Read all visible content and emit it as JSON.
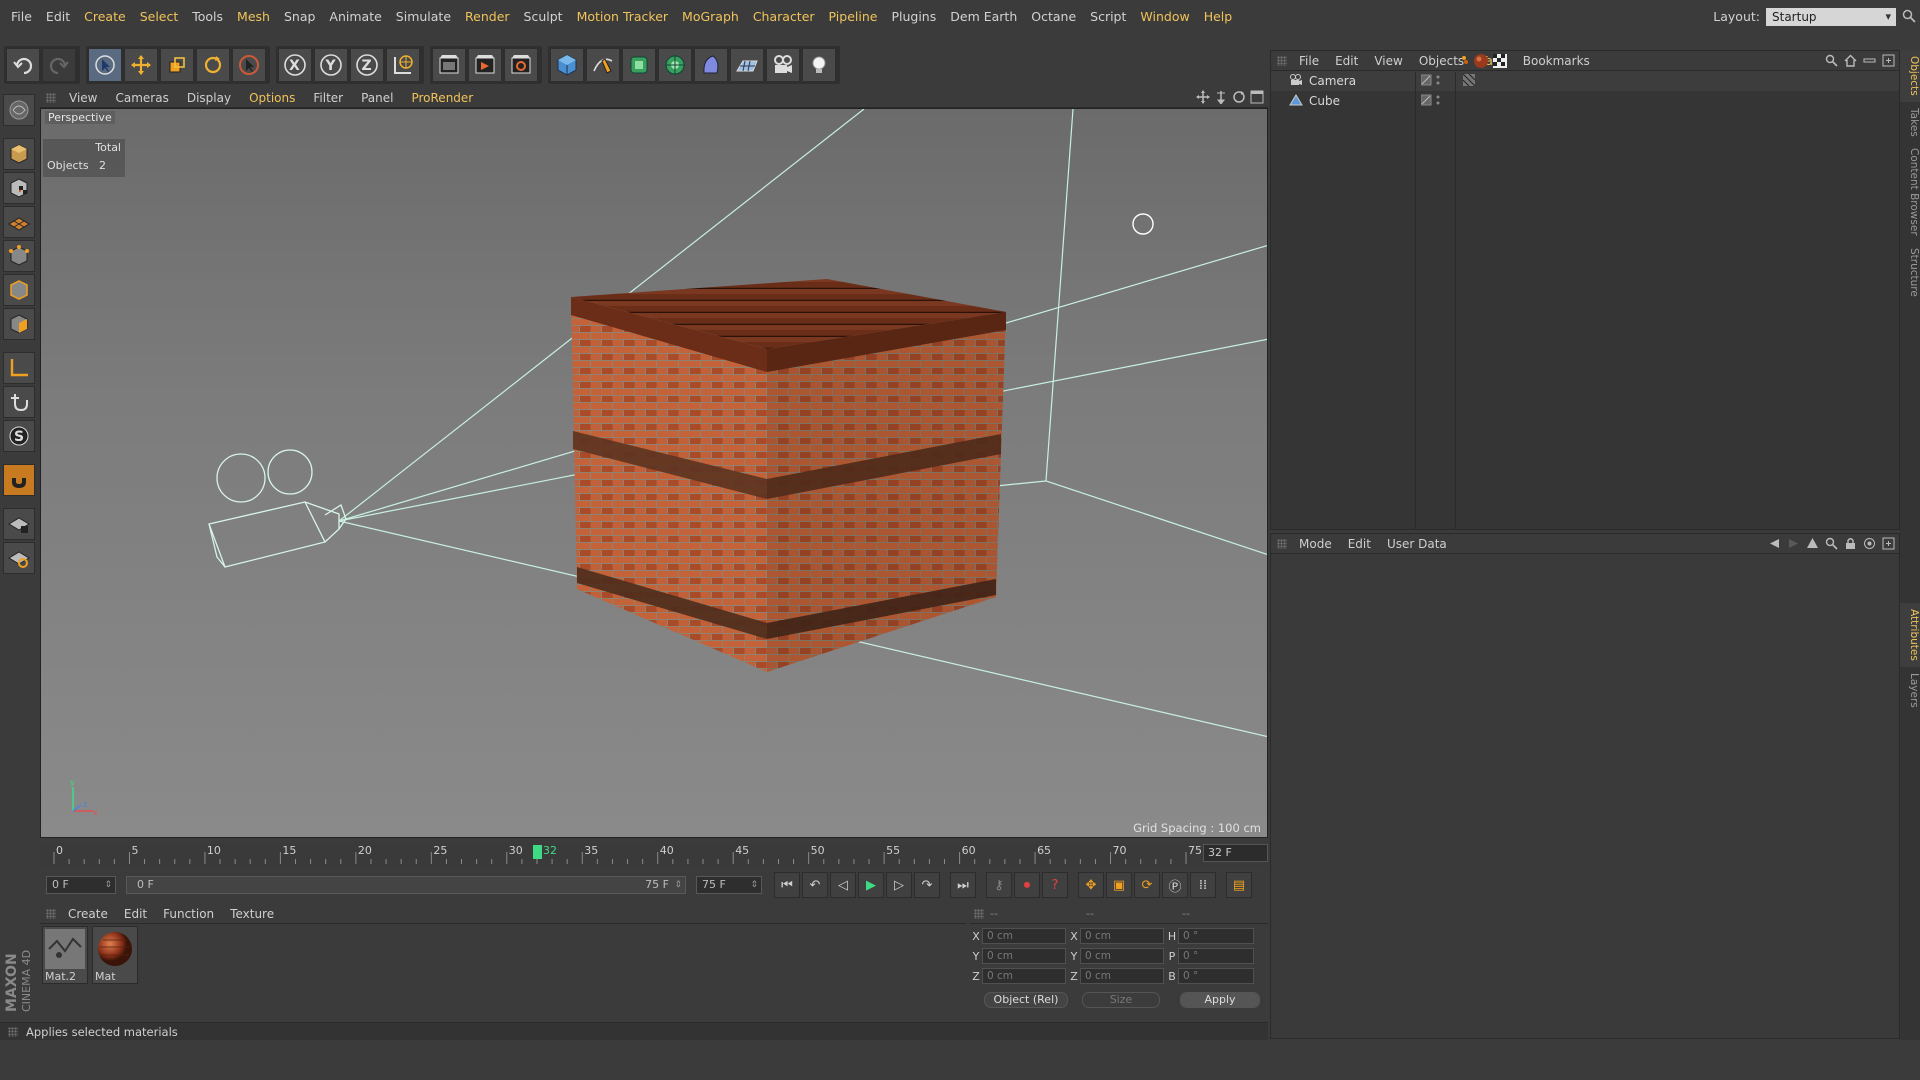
{
  "menubar": {
    "items": [
      {
        "label": "File",
        "hl": false
      },
      {
        "label": "Edit",
        "hl": false
      },
      {
        "label": "Create",
        "hl": true
      },
      {
        "label": "Select",
        "hl": true
      },
      {
        "label": "Tools",
        "hl": false
      },
      {
        "label": "Mesh",
        "hl": true
      },
      {
        "label": "Snap",
        "hl": false
      },
      {
        "label": "Animate",
        "hl": false
      },
      {
        "label": "Simulate",
        "hl": false
      },
      {
        "label": "Render",
        "hl": true
      },
      {
        "label": "Sculpt",
        "hl": false
      },
      {
        "label": "Motion Tracker",
        "hl": true
      },
      {
        "label": "MoGraph",
        "hl": true
      },
      {
        "label": "Character",
        "hl": true
      },
      {
        "label": "Pipeline",
        "hl": true
      },
      {
        "label": "Plugins",
        "hl": false
      },
      {
        "label": "Dem Earth",
        "hl": false
      },
      {
        "label": "Octane",
        "hl": false
      },
      {
        "label": "Script",
        "hl": false
      },
      {
        "label": "Window",
        "hl": true
      },
      {
        "label": "Help",
        "hl": true
      }
    ],
    "layout_label": "Layout:",
    "layout_value": "Startup"
  },
  "toolbar": {
    "icons": [
      "undo-icon",
      "redo-icon",
      "select-arrow-icon",
      "move-icon",
      "scale-icon",
      "rotate-icon",
      "live-select-icon",
      "x-axis-icon",
      "y-axis-icon",
      "z-axis-icon",
      "world-coord-icon",
      "render-view-icon",
      "render-picture-viewer-icon",
      "render-settings-icon",
      "cube-primitive-icon",
      "pen-spline-icon",
      "subdivision-surface-icon",
      "cloner-icon",
      "deformer-icon",
      "floor-icon",
      "camera-icon",
      "light-icon"
    ]
  },
  "viewport": {
    "menu": [
      {
        "label": "View",
        "hl": false
      },
      {
        "label": "Cameras",
        "hl": false
      },
      {
        "label": "Display",
        "hl": false
      },
      {
        "label": "Options",
        "hl": true
      },
      {
        "label": "Filter",
        "hl": false
      },
      {
        "label": "Panel",
        "hl": false
      },
      {
        "label": "ProRender",
        "hl": true
      }
    ],
    "camera_label": "Perspective",
    "hud_header": "Total",
    "hud_objects_label": "Objects",
    "hud_objects_value": "2",
    "grid_spacing": "Grid Spacing : 100 cm"
  },
  "timeline": {
    "ticks": [
      "0",
      "5",
      "10",
      "15",
      "20",
      "25",
      "30",
      "35",
      "40",
      "45",
      "50",
      "55",
      "60",
      "65",
      "70",
      "75"
    ],
    "current_frame": "32",
    "frame_box": "32 F",
    "start_field": "0 F",
    "range_start": "0 F",
    "range_end": "75 F",
    "end_field": "75 F",
    "progress": 0.4267
  },
  "materials": {
    "menu": [
      "Create",
      "Edit",
      "Function",
      "Texture"
    ],
    "items": [
      {
        "name": "Mat.2"
      },
      {
        "name": "Mat"
      }
    ]
  },
  "coords": {
    "headers": [
      "--",
      "--",
      "--"
    ],
    "rows": [
      {
        "a": "X",
        "av": "0 cm",
        "b": "X",
        "bv": "0 cm",
        "c": "H",
        "cv": "0 °"
      },
      {
        "a": "Y",
        "av": "0 cm",
        "b": "Y",
        "bv": "0 cm",
        "c": "P",
        "cv": "0 °"
      },
      {
        "a": "Z",
        "av": "0 cm",
        "b": "Z",
        "bv": "0 cm",
        "c": "B",
        "cv": "0 °"
      }
    ],
    "mode": "Object (Rel)",
    "size": "Size",
    "apply": "Apply"
  },
  "status": "Applies selected materials",
  "object_manager": {
    "menu": [
      {
        "label": "File",
        "hl": false
      },
      {
        "label": "Edit",
        "hl": false
      },
      {
        "label": "View",
        "hl": false
      },
      {
        "label": "Objects",
        "hl": false
      },
      {
        "label": "Tags",
        "hl": true
      },
      {
        "label": "Bookmarks",
        "hl": false
      }
    ],
    "objects": [
      {
        "name": "Camera"
      },
      {
        "name": "Cube"
      }
    ]
  },
  "attribute_manager": {
    "menu": [
      "Mode",
      "Edit",
      "User Data"
    ]
  },
  "right_tabs": [
    {
      "label": "Objects",
      "on": true
    },
    {
      "label": "Takes",
      "on": false
    },
    {
      "label": "Content Browser",
      "on": false
    },
    {
      "label": "Structure",
      "on": false
    },
    {
      "label": "Attributes",
      "on": true
    },
    {
      "label": "Layers",
      "on": false
    }
  ],
  "brand": {
    "line1": "MAXON",
    "line2": "CINEMA 4D"
  },
  "colors": {
    "accent": "#f0c35a",
    "brick": "#b24a2a",
    "playhead": "#3ddc84",
    "wire": "#c8f0e0"
  }
}
